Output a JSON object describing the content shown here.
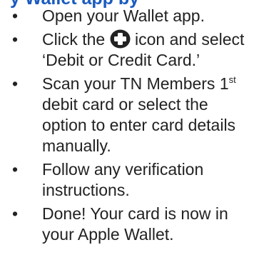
{
  "heading": "y Wallet app by",
  "steps": [
    {
      "text": "Open your Wallet app."
    },
    {
      "before": "Click the ",
      "icon": "plus-circle-icon",
      "after": " icon and select ‘Debit or Credit Card.’"
    },
    {
      "before": "Scan your TN Members 1",
      "sup": "st",
      "after": " debit card or select the option to enter card details manually."
    },
    {
      "text": "Follow any verification instructions."
    },
    {
      "text": "Done! Your card is now in your Apple Wallet."
    }
  ],
  "bullet": "•",
  "colors": {
    "heading": "#1a5bbf",
    "text": "#222222",
    "icon": "#222222"
  }
}
